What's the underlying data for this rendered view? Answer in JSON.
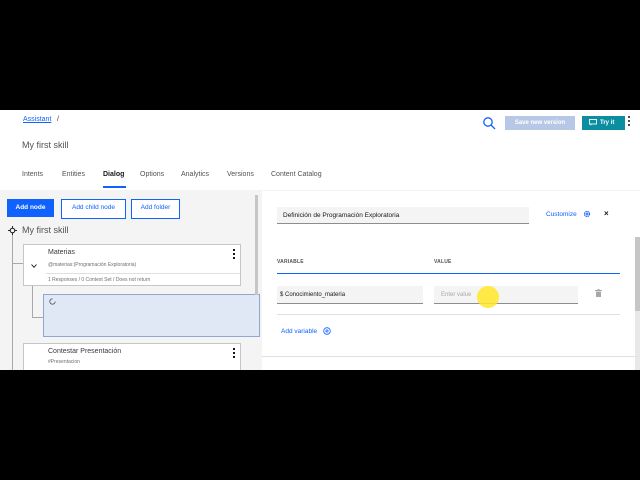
{
  "header": {
    "breadcrumb": "Assistant",
    "breadcrumb_sep": "/",
    "skill_title": "My first skill",
    "save_label": "Save new version",
    "try_label": "Try it",
    "tabs": [
      {
        "label": "Intents"
      },
      {
        "label": "Entities"
      },
      {
        "label": "Dialog",
        "active": true
      },
      {
        "label": "Options"
      },
      {
        "label": "Analytics"
      },
      {
        "label": "Versions"
      },
      {
        "label": "Content Catalog"
      }
    ]
  },
  "toolbar": {
    "add_node": "Add node",
    "add_child_node": "Add child node",
    "add_folder": "Add folder"
  },
  "tree": {
    "root_title": "My first skill",
    "nodes": [
      {
        "title": "Materias",
        "condition": "@materias:(Programación Exploratoria)",
        "info": "1 Responses / 0 Context Set / Does not return"
      },
      {
        "title": "Contestar Presentación",
        "condition": "#Presentacion"
      }
    ]
  },
  "panel": {
    "node_name": "Definición de Programación Exploratoria",
    "customize_label": "Customize",
    "close_label": "×",
    "variable_header": "VARIABLE",
    "value_header": "VALUE",
    "variable_value": "$ Conocimiento_materia",
    "value_placeholder": "Enter value",
    "add_variable_label": "Add variable"
  },
  "colors": {
    "accent": "#0f62fe",
    "try_button": "#0a8ea0",
    "save_button_disabled": "#b7c8e6",
    "cursor_highlight": "#ffe628"
  },
  "icons": [
    "search-icon",
    "chat-icon",
    "overflow-menu-icon",
    "chevron-down-icon",
    "spinner-icon",
    "gear-icon",
    "close-icon",
    "trash-icon",
    "add-circle-icon",
    "root-node-icon"
  ]
}
